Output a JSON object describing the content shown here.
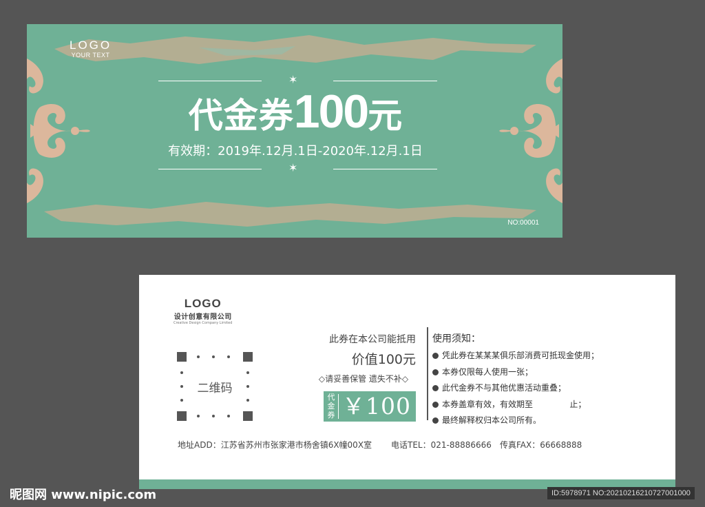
{
  "front": {
    "logo": "LOGO",
    "logo_subtext": "YOUR TEXT",
    "title_cn": "代金券",
    "title_amount": "100",
    "title_unit": "元",
    "validity": "有效期：2019年.12月.1日-2020年.12月.1日",
    "serial": "NO:00001",
    "star_glyph": "✶"
  },
  "back": {
    "logo": "LOGO",
    "company": "设计创意有限公司",
    "company_en": "Creative Design Company Limited",
    "qr_label": "二维码",
    "usage_line1": "此券在本公司能抵用",
    "usage_line2": "价值100元",
    "keep_note": "◇请妥善保管 遗失不补◇",
    "coupon_label": "代金券",
    "coupon_value": "￥100",
    "notice_title": "使用须知：",
    "notice_items": [
      "凭此券在某某某俱乐部消费可抵现金使用；",
      "本券仅限每人使用一张；",
      "此代金券不与其他优惠活动重叠；",
      "本券盖章有效，有效期至              止；",
      "最终解释权归本公司所有。"
    ],
    "address": "地址ADD：江苏省苏州市张家港市杨舍镇6X幢00X室",
    "phone": "电话TEL：021-88886666",
    "fax": "传真FAX：66668888"
  },
  "watermark": {
    "site": "昵图网 www.nipic.com",
    "id_text": "ID:5978971 NO:20210216210727001000"
  },
  "colors": {
    "background": "#555555",
    "accent_green": "#6fb196",
    "brush_tan": "#b3ae92",
    "ornament": "#dcb79c"
  }
}
